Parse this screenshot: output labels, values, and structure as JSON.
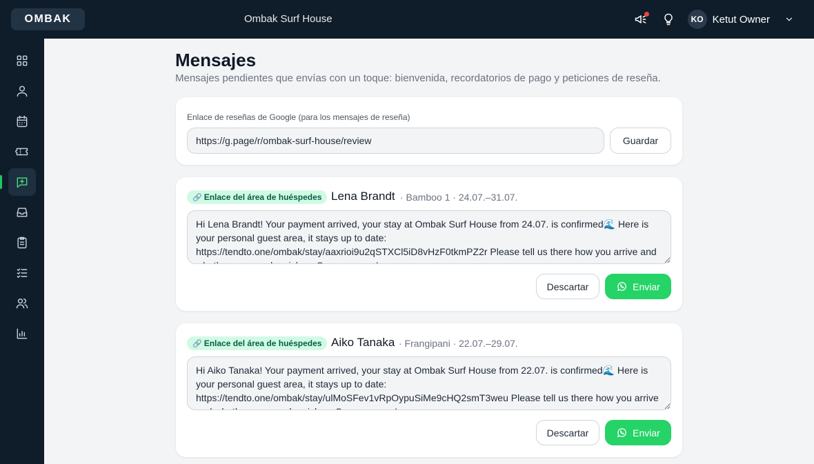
{
  "topbar": {
    "logo": "OMBAK",
    "property": "Ombak Surf House",
    "user_initials": "KO",
    "user_name": "Ketut Owner"
  },
  "sidebar": {
    "items": [
      {
        "icon": "dashboard-icon"
      },
      {
        "icon": "user-icon"
      },
      {
        "icon": "calendar-icon"
      },
      {
        "icon": "ticket-icon"
      },
      {
        "icon": "message-plus-icon",
        "active": true
      },
      {
        "icon": "inbox-icon"
      },
      {
        "icon": "clipboard-icon"
      },
      {
        "icon": "checklist-icon"
      },
      {
        "icon": "users-icon"
      },
      {
        "icon": "bar-chart-icon"
      }
    ]
  },
  "page": {
    "title": "Mensajes",
    "subtitle": "Mensajes pendientes que envías con un toque: bienvenida, recordatorios de pago y peticiones de reseña."
  },
  "review": {
    "label": "Enlace de reseñas de Google (para los mensajes de reseña)",
    "value": "https://g.page/r/ombak-surf-house/review",
    "save_label": "Guardar"
  },
  "messages": [
    {
      "tag": "Enlace del área de huéspedes",
      "guest": "Lena Brandt",
      "meta": "· Bamboo 1 · 24.07.–31.07.",
      "text": "Hi Lena Brandt! Your payment arrived, your stay at Ombak Surf House from 24.07. is confirmed🌊 Here is your personal guest area, it stays up to date: https://tendto.one/ombak/stay/aaxrioi9u2qSTXCl5iD8vHzF0tkmPZ2r Please tell us there how you arrive and whether you need a pickup. See you soon!",
      "discard_label": "Descartar",
      "send_label": "Enviar"
    },
    {
      "tag": "Enlace del área de huéspedes",
      "guest": "Aiko Tanaka",
      "meta": "· Frangipani · 22.07.–29.07.",
      "text": "Hi Aiko Tanaka! Your payment arrived, your stay at Ombak Surf House from 22.07. is confirmed🌊 Here is your personal guest area, it stays up to date: https://tendto.one/ombak/stay/ulMoSFev1vRpOypuSiMe9cHQ2smT3weu Please tell us there how you arrive and whether you need a pickup. See you soon!",
      "discard_label": "Descartar",
      "send_label": "Enviar"
    }
  ],
  "colors": {
    "nav_bg": "#0f1d2b",
    "accent": "#22c55e",
    "whatsapp": "#25d366",
    "pill_bg": "#d1fae5"
  }
}
